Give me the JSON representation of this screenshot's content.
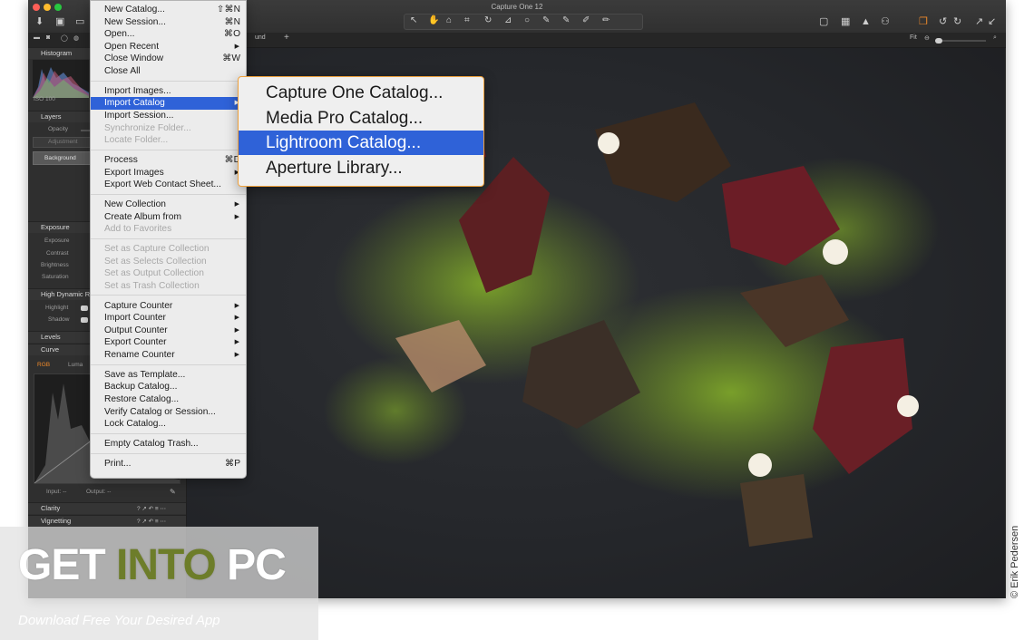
{
  "app": {
    "title": "Capture One 12"
  },
  "toolbar_left": [
    "download-icon",
    "camera-icon",
    "folder-icon"
  ],
  "subbar": {
    "fit_label": "Fit",
    "preset_hint": "und",
    "add": "+"
  },
  "left_panel": {
    "histogram": {
      "title": "Histogram",
      "iso": "ISO 100"
    },
    "layers": {
      "title": "Layers",
      "opacity": "Opacity",
      "adjustment": "Adjustment",
      "background": "Background"
    },
    "exposure": {
      "title": "Exposure",
      "rows": [
        "Exposure",
        "Contrast",
        "Brightness",
        "Saturation"
      ]
    },
    "hdr": {
      "title": "High Dynamic R",
      "rows": [
        "Highlight",
        "Shadow"
      ]
    },
    "levels": {
      "title": "Levels"
    },
    "curve": {
      "title": "Curve",
      "tab_rgb": "RGB",
      "tab_luma": "Luma",
      "input": "Input: --",
      "output": "Output: --"
    },
    "clarity": {
      "title": "Clarity"
    },
    "vignetting": {
      "title": "Vignetting"
    }
  },
  "file_menu": {
    "items": [
      {
        "label": "New Catalog...",
        "shortcut": "⇧⌘N",
        "disabled": false
      },
      {
        "label": "New Session...",
        "shortcut": "⌘N",
        "disabled": false
      },
      {
        "label": "Open...",
        "shortcut": "⌘O",
        "disabled": false
      },
      {
        "label": "Open Recent",
        "shortcut": "▶",
        "disabled": false
      },
      {
        "label": "Close Window",
        "shortcut": "⌘W",
        "disabled": false
      },
      {
        "label": "Close All",
        "shortcut": "",
        "disabled": false
      },
      {
        "sep": true
      },
      {
        "label": "Import Images...",
        "shortcut": "",
        "disabled": false
      },
      {
        "label": "Import Catalog",
        "shortcut": "▶",
        "disabled": false,
        "highlight": true
      },
      {
        "label": "Import Session...",
        "shortcut": "",
        "disabled": false
      },
      {
        "label": "Synchronize Folder...",
        "shortcut": "",
        "disabled": true
      },
      {
        "label": "Locate Folder...",
        "shortcut": "",
        "disabled": true
      },
      {
        "sep": true
      },
      {
        "label": "Process",
        "shortcut": "⌘D",
        "disabled": false
      },
      {
        "label": "Export Images",
        "shortcut": "▶",
        "disabled": false
      },
      {
        "label": "Export Web Contact Sheet...",
        "shortcut": "",
        "disabled": false
      },
      {
        "sep": true
      },
      {
        "label": "New Collection",
        "shortcut": "▶",
        "disabled": false
      },
      {
        "label": "Create Album from",
        "shortcut": "▶",
        "disabled": false
      },
      {
        "label": "Add to Favorites",
        "shortcut": "",
        "disabled": true
      },
      {
        "sep": true
      },
      {
        "label": "Set as Capture Collection",
        "shortcut": "",
        "disabled": true
      },
      {
        "label": "Set as Selects Collection",
        "shortcut": "",
        "disabled": true
      },
      {
        "label": "Set as Output Collection",
        "shortcut": "",
        "disabled": true
      },
      {
        "label": "Set as Trash Collection",
        "shortcut": "",
        "disabled": true
      },
      {
        "sep": true
      },
      {
        "label": "Capture Counter",
        "shortcut": "▶",
        "disabled": false
      },
      {
        "label": "Import Counter",
        "shortcut": "▶",
        "disabled": false
      },
      {
        "label": "Output Counter",
        "shortcut": "▶",
        "disabled": false
      },
      {
        "label": "Export Counter",
        "shortcut": "▶",
        "disabled": false
      },
      {
        "label": "Rename Counter",
        "shortcut": "▶",
        "disabled": false
      },
      {
        "sep": true
      },
      {
        "label": "Save as Template...",
        "shortcut": "",
        "disabled": false
      },
      {
        "label": "Backup Catalog...",
        "shortcut": "",
        "disabled": false
      },
      {
        "label": "Restore Catalog...",
        "shortcut": "",
        "disabled": false
      },
      {
        "label": "Verify Catalog or Session...",
        "shortcut": "",
        "disabled": false
      },
      {
        "label": "Lock Catalog...",
        "shortcut": "",
        "disabled": false
      },
      {
        "sep": true
      },
      {
        "label": "Empty Catalog Trash...",
        "shortcut": "",
        "disabled": false
      },
      {
        "sep": true
      },
      {
        "label": "Print...",
        "shortcut": "⌘P",
        "disabled": false
      }
    ]
  },
  "import_submenu": {
    "items": [
      {
        "label": "Capture One Catalog...",
        "highlight": false
      },
      {
        "label": "Media Pro Catalog...",
        "highlight": false
      },
      {
        "label": "Lightroom Catalog...",
        "highlight": true
      },
      {
        "label": "Aperture Library...",
        "highlight": false
      }
    ]
  },
  "watermark": {
    "title_get": "GET ",
    "title_into": "INTO ",
    "title_pc": "PC",
    "subtitle": "Download Free Your Desired App"
  },
  "credit": "© Erik Pedersen",
  "colors": {
    "highlight": "#2f62d8",
    "accent_orange": "#f0a23c",
    "watermark_green": "#6d7d2a"
  }
}
